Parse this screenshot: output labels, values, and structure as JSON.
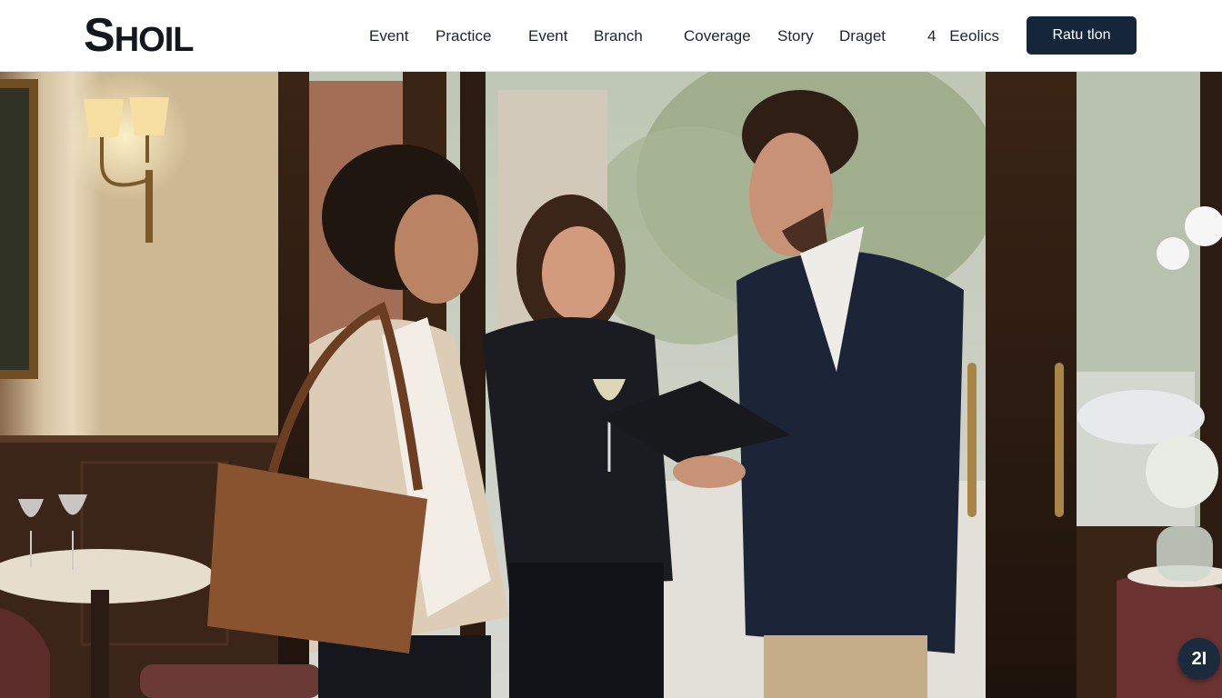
{
  "header": {
    "logo_first": "S",
    "logo_rest": "HOIL",
    "nav": [
      {
        "label": "Event"
      },
      {
        "label": "Practice"
      },
      {
        "label": "Event"
      },
      {
        "label": "Branch"
      },
      {
        "label": "Coverage"
      },
      {
        "label": "Story"
      },
      {
        "label": "Draget"
      }
    ],
    "cart_count": "4",
    "cart_label": "Eeolics",
    "cta_label": "Ratu tlon"
  },
  "hero": {
    "image_subject": "three professionals talking at restaurant entrance"
  },
  "fab": {
    "icon": "chat-icon",
    "label": "2I"
  },
  "colors": {
    "cta_bg": "#16263a",
    "text": "#1e2530"
  }
}
